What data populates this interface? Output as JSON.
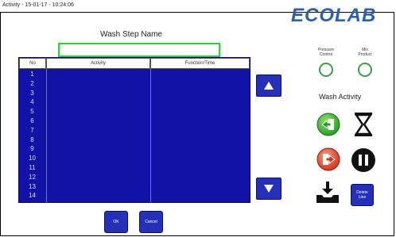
{
  "window": {
    "title": "Activity - 15-01-17 - 10:24:06"
  },
  "brand": {
    "logo": "ECOLAB"
  },
  "wash_step": {
    "label": "Wash Step Name",
    "value": ""
  },
  "table": {
    "headers": {
      "no": "No",
      "activity": "Activity",
      "function": "Function/Time"
    },
    "rows": [
      "1",
      "2",
      "3",
      "4",
      "5",
      "6",
      "7",
      "8",
      "9",
      "10",
      "11",
      "12",
      "13",
      "14"
    ]
  },
  "indicators": {
    "pressure_control": {
      "label_line1": "Pressure",
      "label_line2": "Control"
    },
    "mix_product": {
      "label_line1": "Mix",
      "label_line2": "Product"
    }
  },
  "wash_activity": {
    "label": "Wash Activity"
  },
  "buttons": {
    "ok": "OK",
    "cancel": "Cancel",
    "delete_line_1": "Delete",
    "delete_line_2": "Line"
  },
  "colors": {
    "accent": "#2530b8",
    "grid": "#1212a6",
    "input_border": "#2ed12e",
    "logo": "#2f5fa8"
  }
}
